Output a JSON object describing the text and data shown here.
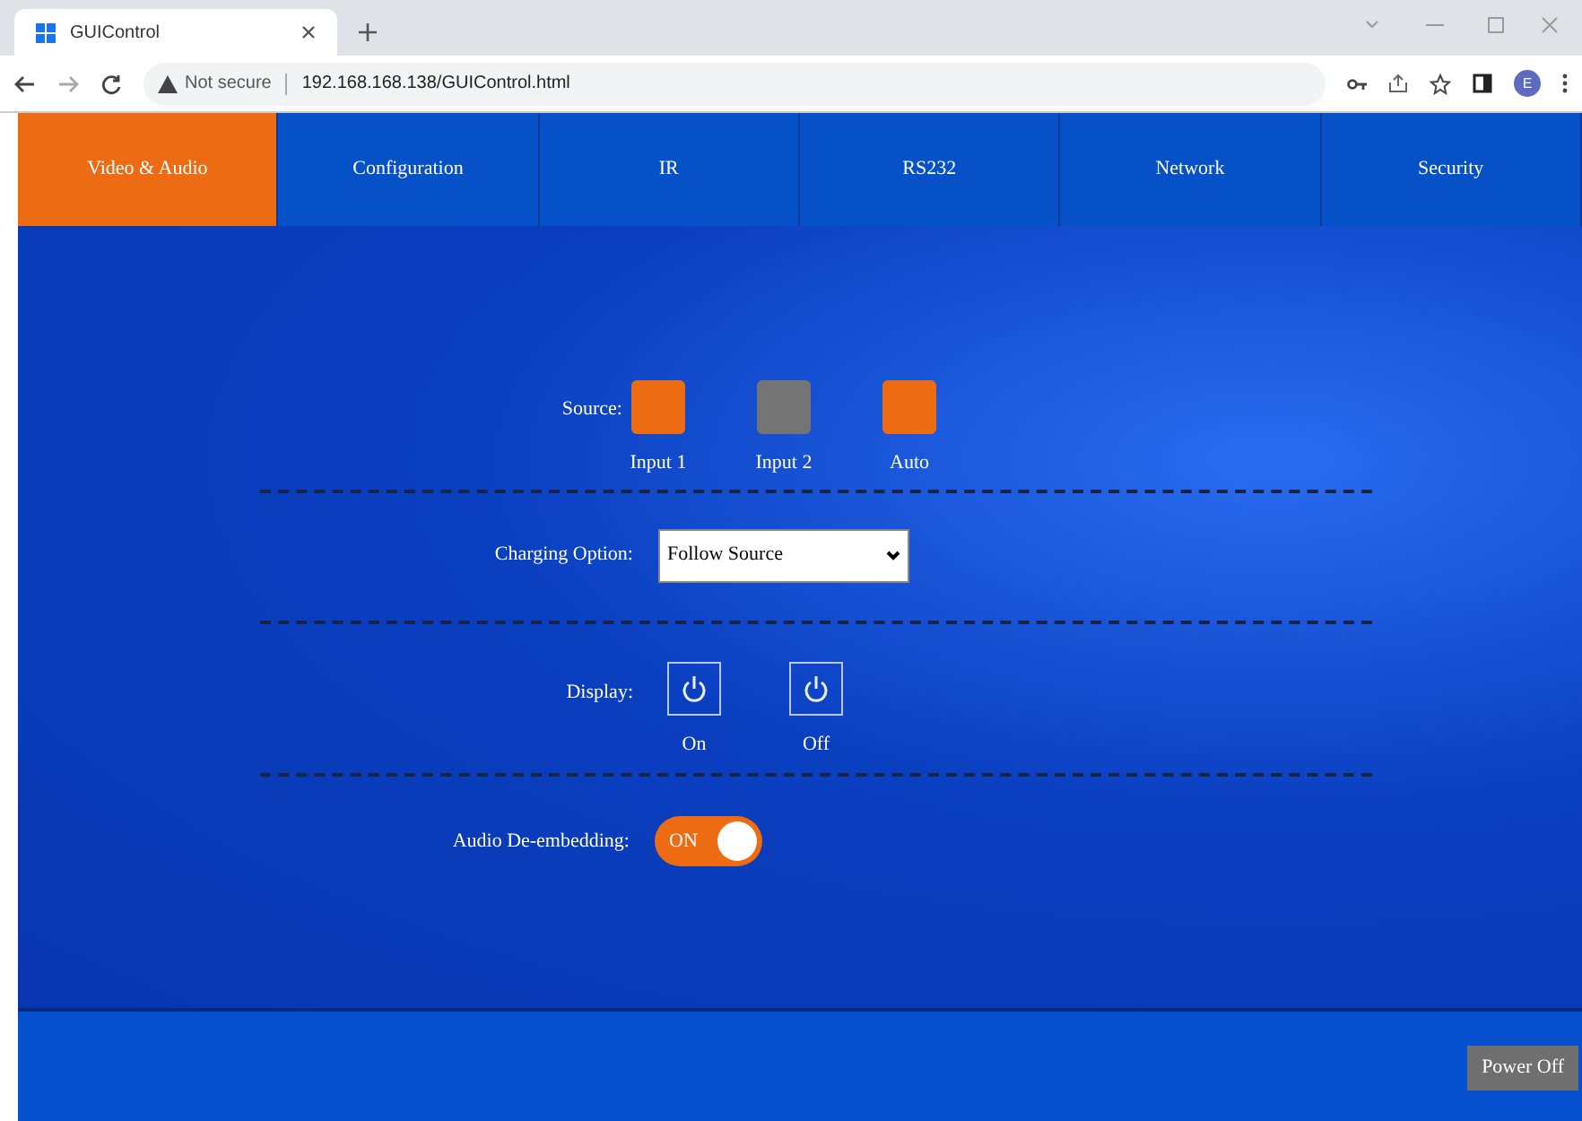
{
  "browser": {
    "tab_title": "GUIControl",
    "security": "Not secure",
    "url": "192.168.168.138/GUIControl.html",
    "profile_initial": "E"
  },
  "nav_tabs": [
    {
      "label": "Video & Audio",
      "selected": true
    },
    {
      "label": "Configuration",
      "selected": false
    },
    {
      "label": "IR",
      "selected": false
    },
    {
      "label": "RS232",
      "selected": false
    },
    {
      "label": "Network",
      "selected": false
    },
    {
      "label": "Security",
      "selected": false
    }
  ],
  "source": {
    "label": "Source:",
    "options": [
      {
        "label": "Input 1",
        "on": true
      },
      {
        "label": "Input 2",
        "on": false
      },
      {
        "label": "Auto",
        "on": true
      }
    ]
  },
  "charging_option": {
    "label": "Charging Option:",
    "value": "Follow Source"
  },
  "display": {
    "label": "Display:",
    "buttons": [
      {
        "label": "On"
      },
      {
        "label": "Off"
      }
    ]
  },
  "audio_deembedding": {
    "label": "Audio De-embedding:",
    "on": true,
    "state_text": "ON"
  },
  "power_button": "Power Off"
}
